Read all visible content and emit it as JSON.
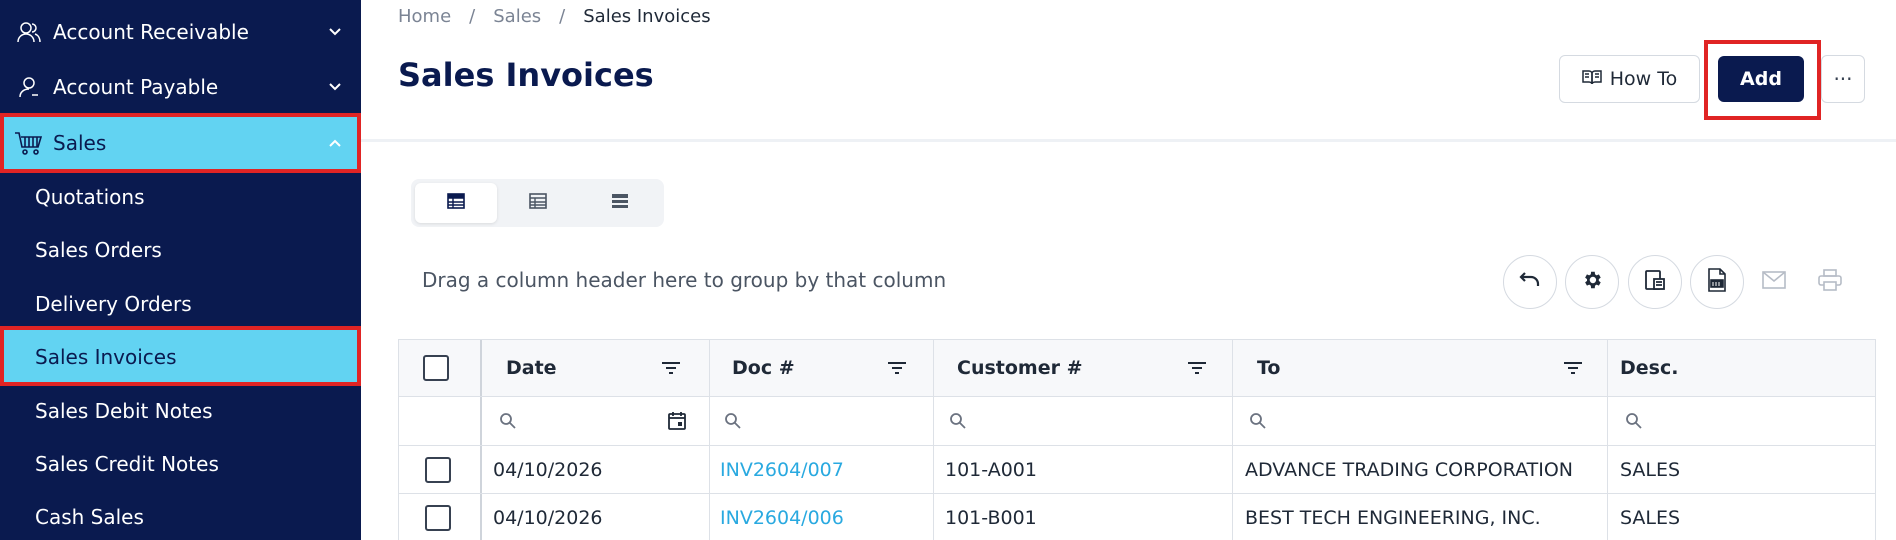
{
  "sidebar": {
    "items": [
      {
        "label": "Account Receivable",
        "icon": "users-icon"
      },
      {
        "label": "Account Payable",
        "icon": "user-icon"
      },
      {
        "label": "Sales",
        "icon": "cart-icon"
      }
    ],
    "sub_items": [
      {
        "label": "Quotations"
      },
      {
        "label": "Sales Orders"
      },
      {
        "label": "Delivery Orders"
      },
      {
        "label": "Sales Invoices"
      },
      {
        "label": "Sales Debit Notes"
      },
      {
        "label": "Sales Credit Notes"
      },
      {
        "label": "Cash Sales"
      }
    ]
  },
  "breadcrumb": {
    "home": "Home",
    "separator": "/",
    "sales": "Sales",
    "current": "Sales Invoices"
  },
  "page": {
    "title": "Sales Invoices",
    "howto_label": "How To",
    "add_label": "Add",
    "more_label": "···"
  },
  "grid": {
    "group_hint": "Drag a column header here to group by that column",
    "columns": [
      "Date",
      "Doc #",
      "Customer #",
      "To",
      "Desc."
    ],
    "rows": [
      {
        "date": "04/10/2026",
        "doc": "INV2604/007",
        "customer": "101-A001",
        "to": "ADVANCE TRADING CORPORATION",
        "desc": "SALES"
      },
      {
        "date": "04/10/2026",
        "doc": "INV2604/006",
        "customer": "101-B001",
        "to": "BEST TECH ENGINEERING, INC.",
        "desc": "SALES"
      }
    ]
  },
  "colors": {
    "sidebar_bg": "#0a1a4f",
    "active_bg": "#62d3f2",
    "highlight": "#e02424",
    "link": "#29a9e0",
    "primary": "#0a1a4f"
  }
}
